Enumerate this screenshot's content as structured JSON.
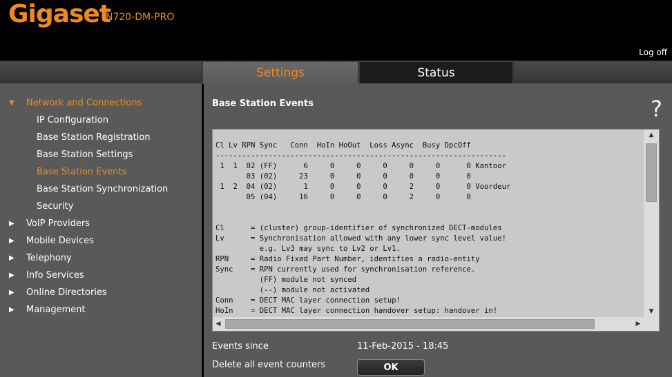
{
  "header": {
    "logo": "Gigaset",
    "model": "N720-DM-PRO",
    "logoff_label": "Log off"
  },
  "tabs": [
    {
      "label": "Settings",
      "active": true
    },
    {
      "label": "Status",
      "active": false
    }
  ],
  "sidebar": {
    "items": [
      {
        "label": "Network and Connections",
        "expanded": true,
        "children": [
          {
            "label": "IP Configuration"
          },
          {
            "label": "Base Station Registration"
          },
          {
            "label": "Base Station Settings"
          },
          {
            "label": "Base Station Events",
            "active": true
          },
          {
            "label": "Base Station Synchronization"
          },
          {
            "label": "Security"
          }
        ]
      },
      {
        "label": "VoIP Providers"
      },
      {
        "label": "Mobile Devices"
      },
      {
        "label": "Telephony"
      },
      {
        "label": "Info Services"
      },
      {
        "label": "Online Directories"
      },
      {
        "label": "Management"
      }
    ]
  },
  "main": {
    "title": "Base Station Events",
    "help_icon": "?",
    "log_text": "Cl Lv RPN Sync   Conn  HoIn HoOut  Loss Async  Busy DpcOff\n------------------------------------------------------------------\n 1  1  02 (FF)      6     0     0     0     0     0      0 Kantoor\n       03 (02)     23     0     0     0     0     0      0\n 1  2  04 (02)      1     0     0     0     2     0      0 Voordeur\n       05 (04)     16     0     0     0     2     0      0\n\n\nCl      = (cluster) group-identifier of synchronized DECT-modules\nLv      = Synchronisation allowed with any lower sync level value!\n          e.g. Lv3 may sync to Lv2 or Lv1.\nRPN     = Radio Fixed Part Number, identifies a radio-entity\nSync    = RPN currently used for synchronisation reference.\n          (FF) module not synced\n          (--) module not activated\nConn    = DECT MAC layer connection setup!\nHoIn    = DECT MAC layer connection handover setup: handover in!",
    "events_since_label": "Events since",
    "events_since_value": "11-Feb-2015 - 18:45",
    "delete_label": "Delete all event counters",
    "ok_label": "OK"
  },
  "colors": {
    "accent": "#f08a1c",
    "panel": "#595959",
    "background": "#000000",
    "log_bg": "#c9c9c9"
  }
}
